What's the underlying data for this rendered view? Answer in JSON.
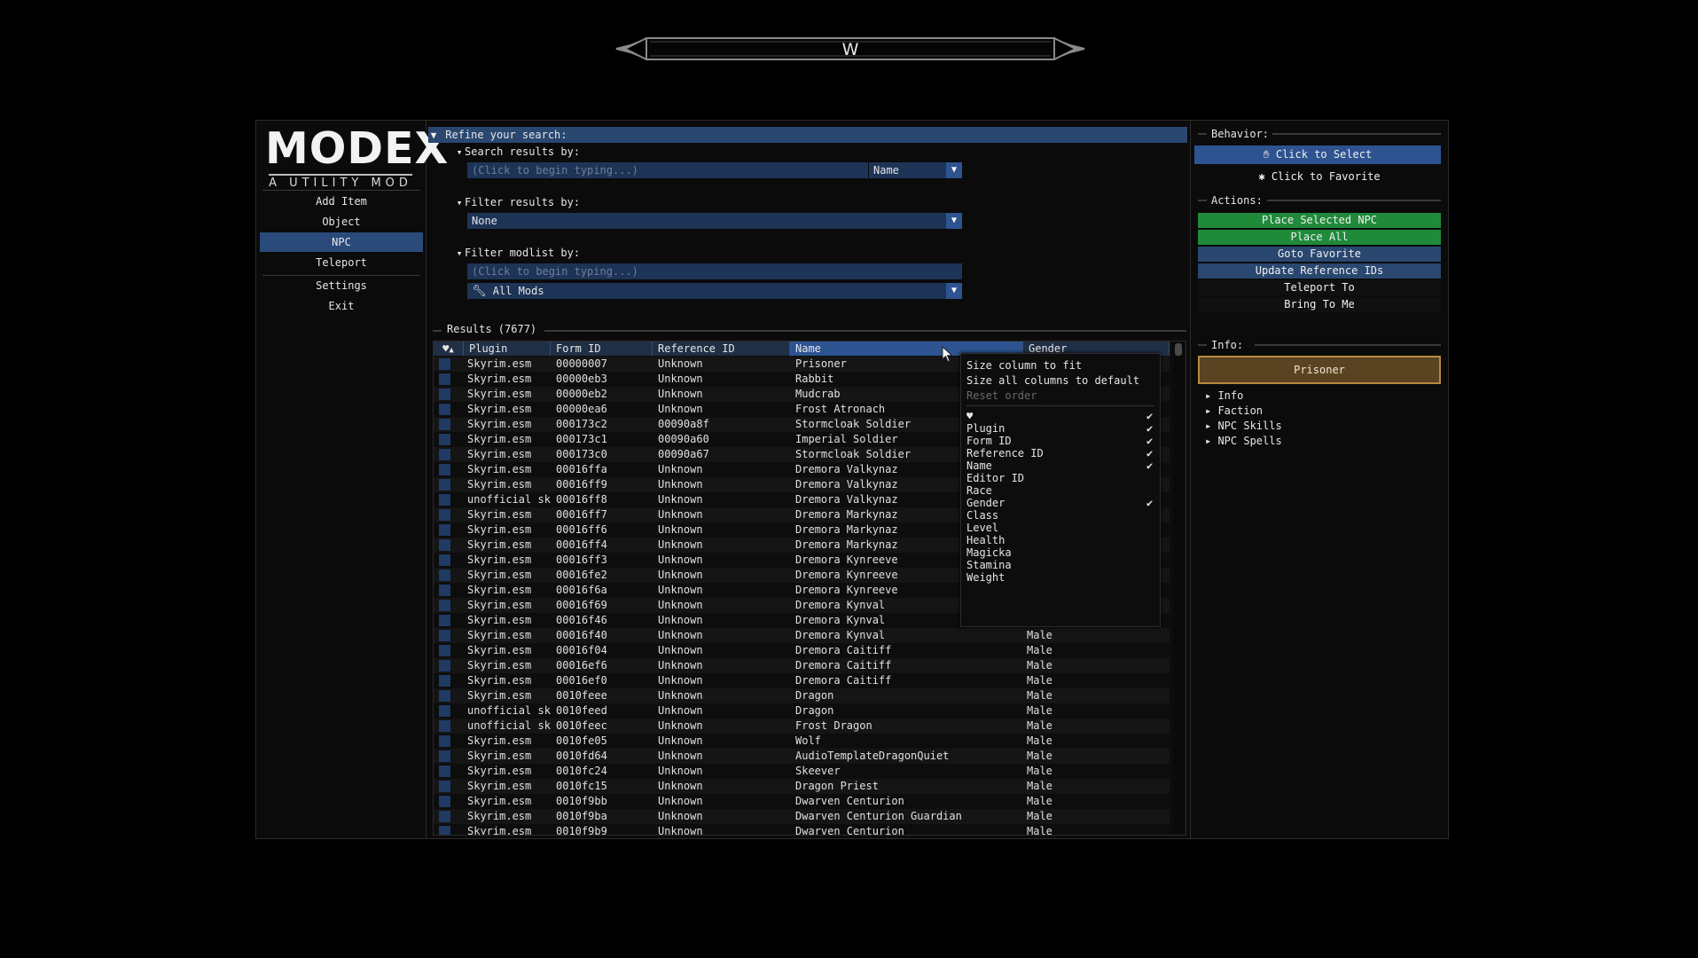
{
  "compass": {
    "heading": "W"
  },
  "sidebar": {
    "logo_title": "MODEX",
    "logo_subtitle": "A UTILITY MOD",
    "items": [
      {
        "label": "Add Item"
      },
      {
        "label": "Object"
      },
      {
        "label": "NPC",
        "active": true
      },
      {
        "label": "Teleport"
      },
      {
        "label": "Settings"
      },
      {
        "label": "Exit"
      }
    ]
  },
  "search": {
    "header": "Refine your search:",
    "search_by_label": "Search results by:",
    "search_placeholder": "(Click to begin typing...)",
    "search_field_value": "Name",
    "filter_by_label": "Filter results by:",
    "filter_value": "None",
    "modlist_label": "Filter modlist by:",
    "modlist_placeholder": "(Click to begin typing...)",
    "modlist_value": "All Mods"
  },
  "results": {
    "title": "Results (7677)",
    "columns": [
      "Plugin",
      "Form ID",
      "Reference ID",
      "Name",
      "Gender"
    ],
    "sorted_column": "Name",
    "rows": [
      [
        "Skyrim.esm",
        "00000007",
        "Unknown",
        "Prisoner",
        ""
      ],
      [
        "Skyrim.esm",
        "00000eb3",
        "Unknown",
        "Rabbit",
        ""
      ],
      [
        "Skyrim.esm",
        "00000eb2",
        "Unknown",
        "Mudcrab",
        ""
      ],
      [
        "Skyrim.esm",
        "00000ea6",
        "Unknown",
        "Frost Atronach",
        ""
      ],
      [
        "Skyrim.esm",
        "000173c2",
        "00090a8f",
        "Stormcloak Soldier",
        ""
      ],
      [
        "Skyrim.esm",
        "000173c1",
        "00090a60",
        "Imperial Soldier",
        ""
      ],
      [
        "Skyrim.esm",
        "000173c0",
        "00090a67",
        "Stormcloak Soldier",
        ""
      ],
      [
        "Skyrim.esm",
        "00016ffa",
        "Unknown",
        "Dremora Valkynaz",
        ""
      ],
      [
        "Skyrim.esm",
        "00016ff9",
        "Unknown",
        "Dremora Valkynaz",
        ""
      ],
      [
        "unofficial skyrim",
        "00016ff8",
        "Unknown",
        "Dremora Valkynaz",
        ""
      ],
      [
        "Skyrim.esm",
        "00016ff7",
        "Unknown",
        "Dremora Markynaz",
        ""
      ],
      [
        "Skyrim.esm",
        "00016ff6",
        "Unknown",
        "Dremora Markynaz",
        ""
      ],
      [
        "Skyrim.esm",
        "00016ff4",
        "Unknown",
        "Dremora Markynaz",
        ""
      ],
      [
        "Skyrim.esm",
        "00016ff3",
        "Unknown",
        "Dremora Kynreeve",
        ""
      ],
      [
        "Skyrim.esm",
        "00016fe2",
        "Unknown",
        "Dremora Kynreeve",
        ""
      ],
      [
        "Skyrim.esm",
        "00016f6a",
        "Unknown",
        "Dremora Kynreeve",
        ""
      ],
      [
        "Skyrim.esm",
        "00016f69",
        "Unknown",
        "Dremora Kynval",
        ""
      ],
      [
        "Skyrim.esm",
        "00016f46",
        "Unknown",
        "Dremora Kynval",
        ""
      ],
      [
        "Skyrim.esm",
        "00016f40",
        "Unknown",
        "Dremora Kynval",
        "Male"
      ],
      [
        "Skyrim.esm",
        "00016f04",
        "Unknown",
        "Dremora Caitiff",
        "Male"
      ],
      [
        "Skyrim.esm",
        "00016ef6",
        "Unknown",
        "Dremora Caitiff",
        "Male"
      ],
      [
        "Skyrim.esm",
        "00016ef0",
        "Unknown",
        "Dremora Caitiff",
        "Male"
      ],
      [
        "Skyrim.esm",
        "0010feee",
        "Unknown",
        "Dragon",
        "Male"
      ],
      [
        "unofficial skyrim",
        "0010feed",
        "Unknown",
        "Dragon",
        "Male"
      ],
      [
        "unofficial skyrim",
        "0010feec",
        "Unknown",
        "Frost Dragon",
        "Male"
      ],
      [
        "Skyrim.esm",
        "0010fe05",
        "Unknown",
        "Wolf",
        "Male"
      ],
      [
        "Skyrim.esm",
        "0010fd64",
        "Unknown",
        "AudioTemplateDragonQuiet",
        "Male"
      ],
      [
        "Skyrim.esm",
        "0010fc24",
        "Unknown",
        "Skeever",
        "Male"
      ],
      [
        "Skyrim.esm",
        "0010fc15",
        "Unknown",
        "Dragon Priest",
        "Male"
      ],
      [
        "Skyrim.esm",
        "0010f9bb",
        "Unknown",
        "Dwarven Centurion",
        "Male"
      ],
      [
        "Skyrim.esm",
        "0010f9ba",
        "Unknown",
        "Dwarven Centurion Guardian",
        "Male"
      ],
      [
        "Skyrim.esm",
        "0010f9b9",
        "Unknown",
        "Dwarven Centurion",
        "Male"
      ]
    ]
  },
  "context_menu": {
    "top_items": [
      "Size column to fit",
      "Size all columns to default"
    ],
    "reset_label": "Reset order",
    "columns": [
      {
        "label": "",
        "checked": true,
        "icon": "heart-icon"
      },
      {
        "label": "Plugin",
        "checked": true
      },
      {
        "label": "Form ID",
        "checked": true
      },
      {
        "label": "Reference ID",
        "checked": true
      },
      {
        "label": "Name",
        "checked": true
      },
      {
        "label": "Editor ID",
        "checked": false
      },
      {
        "label": "Race",
        "checked": false
      },
      {
        "label": "Gender",
        "checked": true
      },
      {
        "label": "Class",
        "checked": false
      },
      {
        "label": "Level",
        "checked": false
      },
      {
        "label": "Health",
        "checked": false
      },
      {
        "label": "Magicka",
        "checked": false
      },
      {
        "label": "Stamina",
        "checked": false
      },
      {
        "label": "Weight",
        "checked": false
      }
    ],
    "check_glyph": "✔"
  },
  "right_panel": {
    "behavior_label": "Behavior:",
    "click_to_select": "Click to Select",
    "click_to_favorite": "Click to Favorite",
    "actions_label": "Actions:",
    "actions": [
      {
        "label": "Place Selected NPC",
        "style": "green"
      },
      {
        "label": "Place All",
        "style": "green"
      },
      {
        "label": "Goto Favorite",
        "style": "navy"
      },
      {
        "label": "Update Reference IDs",
        "style": "navy"
      },
      {
        "label": "Teleport To",
        "style": "plain"
      },
      {
        "label": "Bring To Me",
        "style": "plain"
      }
    ],
    "info_label": "Info:",
    "selected_name": "Prisoner",
    "tree": [
      "Info",
      "Faction",
      "NPC Skills",
      "NPC Spells"
    ]
  },
  "colors": {
    "accent": "#2d5390",
    "green": "#1f8a3a",
    "gold": "#b78b3f"
  }
}
